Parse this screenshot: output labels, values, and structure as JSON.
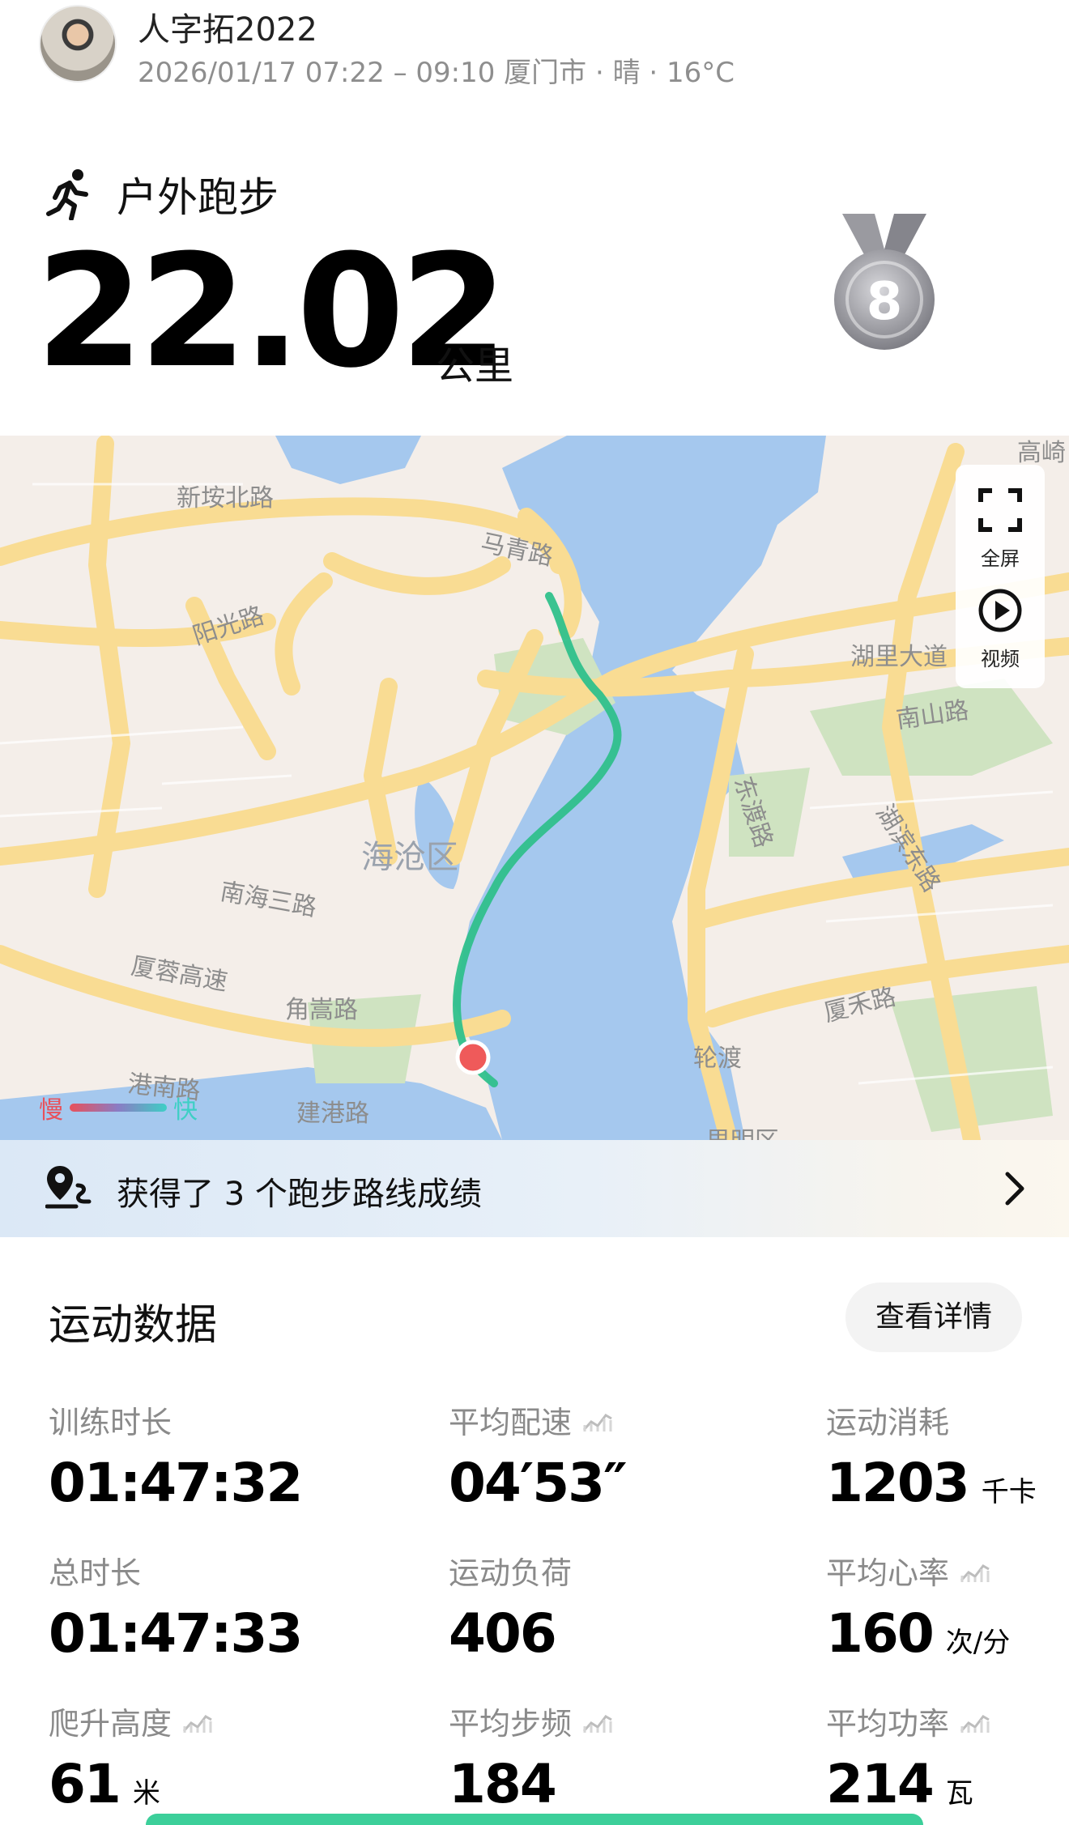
{
  "header": {
    "username": "人字拓2022",
    "meta": "2026/01/17 07:22 – 09:10 厦门市 · 晴 · 16°C"
  },
  "activity": {
    "type": "户外跑步",
    "distance": "22.02",
    "unit": "公里",
    "medal_number": "8",
    "medal_color": "#8e8e95"
  },
  "map": {
    "labels": [
      "新垵北路",
      "马青路",
      "阳光路",
      "湖里大道",
      "南山路",
      "海沧区",
      "南海三路",
      "东渡路",
      "湖滨东路",
      "厦蓉高速",
      "角嵩路",
      "厦禾路",
      "港南路",
      "轮渡",
      "建港路",
      "思明区",
      "高崎"
    ],
    "controls": {
      "fullscreen": "全屏",
      "video": "视频"
    },
    "legend": {
      "slow": "慢",
      "fast": "快"
    },
    "route_color": "#2fc08b",
    "water_color": "#a5c8ee",
    "road_color": "#f9dc93",
    "green_color": "#cfe3c1"
  },
  "banner": {
    "text": "获得了 3 个跑步路线成绩"
  },
  "stats": {
    "title": "运动数据",
    "detail_button": "查看详情",
    "items": [
      {
        "label": "训练时长",
        "value": "01:47:32",
        "unit": "",
        "trend": false
      },
      {
        "label": "平均配速",
        "value": "04′53″",
        "unit": "",
        "trend": true
      },
      {
        "label": "运动消耗",
        "value": "1203",
        "unit": "千卡",
        "trend": false
      },
      {
        "label": "总时长",
        "value": "01:47:33",
        "unit": "",
        "trend": false
      },
      {
        "label": "运动负荷",
        "value": "406",
        "unit": "",
        "trend": false
      },
      {
        "label": "平均心率",
        "value": "160",
        "unit": "次/分",
        "trend": true
      },
      {
        "label": "爬升高度",
        "value": "61",
        "unit": "米",
        "trend": true
      },
      {
        "label": "平均步频",
        "value": "184",
        "unit": "",
        "trend": true
      },
      {
        "label": "平均功率",
        "value": "214",
        "unit": "瓦",
        "trend": true
      }
    ]
  }
}
